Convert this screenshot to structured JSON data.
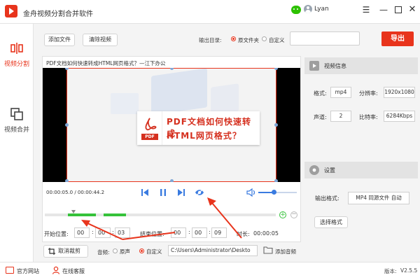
{
  "app": {
    "title": "金舟视频分割合并软件",
    "username": "Lyan"
  },
  "window": {
    "menu_glyph": "☰",
    "min_glyph": "—",
    "close_glyph": "✕"
  },
  "sidebar": {
    "items": [
      {
        "label": "视频分割",
        "active": true
      },
      {
        "label": "视频合并",
        "active": false
      }
    ]
  },
  "toolbar": {
    "add_file": "添加文件",
    "clear_video": "清除视频",
    "output_dir_label": "输出目录:",
    "output_options": [
      {
        "label": "原文件夹",
        "selected": true
      },
      {
        "label": "自定义",
        "selected": false
      }
    ],
    "output_path": "",
    "export": "导出"
  },
  "video": {
    "title": "PDF文档如何快速转成HTML网页格式？—江下办公",
    "pdf_tag": "PDF",
    "overlay_line1": "PDF文档如何快速转成",
    "overlay_line2": "HTML网页格式？",
    "time": "00:00:05.0 / 00:00:44.2"
  },
  "trim": {
    "start_label": "开始位置:",
    "start": [
      "00",
      "00",
      "03"
    ],
    "end_label": "结束位置:",
    "end": [
      "00",
      "00",
      "09"
    ],
    "duration_label": "时长:",
    "duration": "00:00:05",
    "sep": ":"
  },
  "bottom": {
    "cancel_crop": "取消裁剪",
    "audio_label": "音频:",
    "audio_options": [
      {
        "label": "原声",
        "selected": false
      },
      {
        "label": "自定义",
        "selected": true
      }
    ],
    "audio_path": "C:\\Users\\Administrator\\Deskto",
    "add_audio": "添加音频"
  },
  "video_info": {
    "header": "视频信息",
    "format_label": "格式:",
    "format": "mp4",
    "resolution_label": "分辨率:",
    "resolution": "1920x1080",
    "channels_label": "声道:",
    "channels": "2",
    "bitrate_label": "比特率:",
    "bitrate": "6284Kbps"
  },
  "settings": {
    "header": "设置",
    "output_format_label": "输出格式:",
    "output_format": "MP4 同源文件 自动",
    "select_format": "选择格式"
  },
  "statusbar": {
    "site": "官方网站",
    "service": "在线客服",
    "version_label": "版本:",
    "version": "V2.5.5"
  },
  "colors": {
    "accent": "#e8341c",
    "green": "#35c23a",
    "blue": "#3a7be0"
  }
}
